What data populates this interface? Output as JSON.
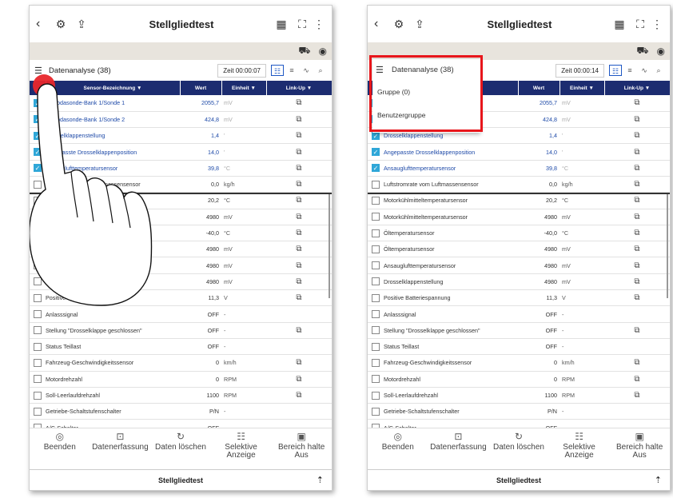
{
  "app": {
    "title": "Stellgliedtest",
    "footer_title": "Stellgliedtest"
  },
  "toolbar": {
    "data_title": "Datenanalyse (38)",
    "time_left": "Zeit 00:00:07",
    "time_right": "Zeit 00:00:14"
  },
  "columns": {
    "name": "Sensor-Bezeichnung",
    "value": "Wert",
    "unit": "Einheit",
    "link": "Link-Up"
  },
  "rows": [
    {
      "name": "Lambdasonde-Bank 1/Sonde 1",
      "value": "2055,7",
      "unit": "mV",
      "selected": true,
      "link": true
    },
    {
      "name": "Lambdasonde-Bank 1/Sonde 2",
      "value": "424,8",
      "unit": "mV",
      "selected": true,
      "link": true
    },
    {
      "name": "Drosselklappenstellung",
      "value": "1,4",
      "unit": "'",
      "selected": true,
      "link": true
    },
    {
      "name": "Angepasste Drosselklappenposition",
      "value": "14,0",
      "unit": "'",
      "selected": true,
      "link": true
    },
    {
      "name": "Ansauglufttemperatursensor",
      "value": "39,8",
      "unit": "°C",
      "selected": true,
      "link": true
    },
    {
      "name": "Luftstromrate vom Luftmassensensor",
      "value": "0,0",
      "unit": "kg/h",
      "selected": false,
      "link": true
    },
    {
      "name": "Motorkühlmitteltemperatursensor",
      "value": "20,2",
      "unit": "°C",
      "selected": false,
      "link": true
    },
    {
      "name": "Motorkühlmitteltemperatursensor",
      "value": "4980",
      "unit": "mV",
      "selected": false,
      "link": true
    },
    {
      "name": "Öltemperatursensor",
      "value": "-40,0",
      "unit": "°C",
      "selected": false,
      "link": true
    },
    {
      "name": "Öltemperatursensor",
      "value": "4980",
      "unit": "mV",
      "selected": false,
      "link": true
    },
    {
      "name": "Ansauglufttemperatursensor",
      "value": "4980",
      "unit": "mV",
      "selected": false,
      "link": true
    },
    {
      "name": "Drosselklappenstellung",
      "value": "4980",
      "unit": "mV",
      "selected": false,
      "link": true
    },
    {
      "name": "Positive Batteriespannung",
      "value": "11,3",
      "unit": "V",
      "selected": false,
      "link": true
    },
    {
      "name": "Anlasssignal",
      "value": "OFF",
      "unit": "-",
      "selected": false,
      "link": false
    },
    {
      "name": "Stellung \"Drosselklappe geschlossen\"",
      "value": "OFF",
      "unit": "-",
      "selected": false,
      "link": true
    },
    {
      "name": "Status Teillast",
      "value": "OFF",
      "unit": "-",
      "selected": false,
      "link": false
    },
    {
      "name": "Fahrzeug-Geschwindigkeitssensor",
      "value": "0",
      "unit": "km/h",
      "selected": false,
      "link": true
    },
    {
      "name": "Motordrehzahl",
      "value": "0",
      "unit": "RPM",
      "selected": false,
      "link": true
    },
    {
      "name": "Soll-Leerlaufdrehzahl",
      "value": "1100",
      "unit": "RPM",
      "selected": false,
      "link": true
    },
    {
      "name": "Getriebe-Schaltstufenschalter",
      "value": "P/N",
      "unit": "-",
      "selected": false,
      "link": false
    },
    {
      "name": "A/C-Schalter",
      "value": "OFF",
      "unit": "-",
      "selected": false,
      "link": false
    }
  ],
  "nav": [
    {
      "label": "Beenden",
      "icon": "stop-circle-icon"
    },
    {
      "label": "Datenerfassung",
      "icon": "record-icon"
    },
    {
      "label": "Daten löschen",
      "icon": "refresh-icon"
    },
    {
      "label": "Selektive Anzeige",
      "icon": "filter-list-icon"
    },
    {
      "label": "Bereich halte Aus",
      "icon": "lock-icon"
    }
  ],
  "popup": {
    "title": "Datenanalyse (38)",
    "items": [
      "Gruppe (0)",
      "Benutzergruppe"
    ]
  },
  "colors": {
    "header": "#1c2c70",
    "selected_text": "#1e4aa8",
    "checkbox": "#2fa7d8",
    "highlight": "#e8161b",
    "touch_dot": "#e8262b"
  }
}
